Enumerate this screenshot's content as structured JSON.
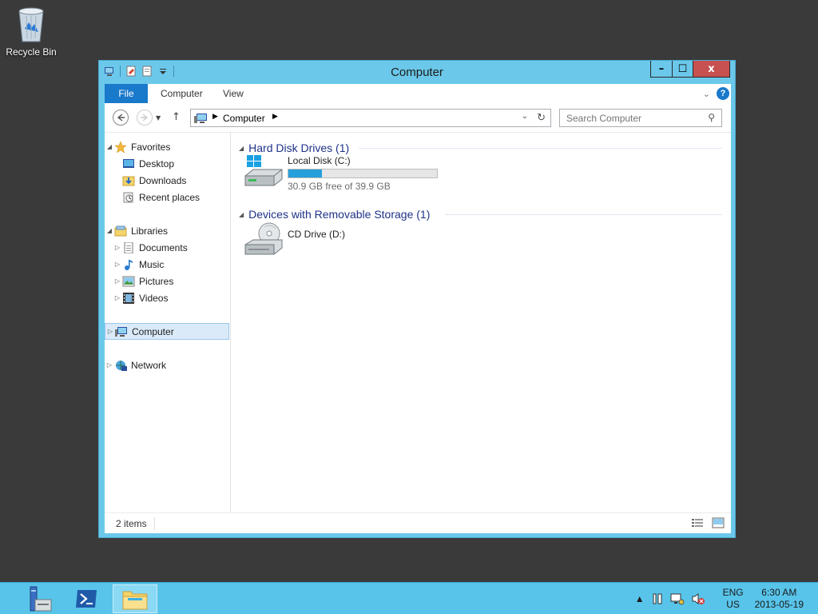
{
  "desktop": {
    "recycle_bin_label": "Recycle Bin"
  },
  "window": {
    "title": "Computer",
    "controls": {
      "minimize": "–",
      "maximize": "☐",
      "close": "x"
    },
    "ribbon": {
      "tabs": [
        "File",
        "Computer",
        "View"
      ]
    },
    "address": {
      "segment": "Computer"
    },
    "search": {
      "placeholder": "Search Computer"
    },
    "nav": {
      "favorites": "Favorites",
      "favorites_items": [
        "Desktop",
        "Downloads",
        "Recent places"
      ],
      "libraries": "Libraries",
      "libraries_items": [
        "Documents",
        "Music",
        "Pictures",
        "Videos"
      ],
      "computer": "Computer",
      "network": "Network"
    },
    "groups": [
      {
        "header": "Hard Disk Drives (1)",
        "drive_name": "Local Disk (C:)",
        "free_text": "30.9 GB free of 39.9 GB",
        "used_fraction": 0.226
      },
      {
        "header": "Devices with Removable Storage (1)",
        "drive_name": "CD Drive (D:)"
      }
    ],
    "status": {
      "item_count": "2 items"
    }
  },
  "taskbar": {
    "lang_line1": "ENG",
    "lang_line2": "US",
    "time": "6:30 AM",
    "date": "2013-05-19"
  },
  "colors": {
    "window_frame": "#6bc8ea",
    "taskbar": "#58c4ea",
    "file_tab": "#1979ca",
    "close_button": "#c75050",
    "usage_bar": "#26a0da",
    "group_header_text": "#1e3287",
    "desktop_bg": "#3a3a3a"
  }
}
